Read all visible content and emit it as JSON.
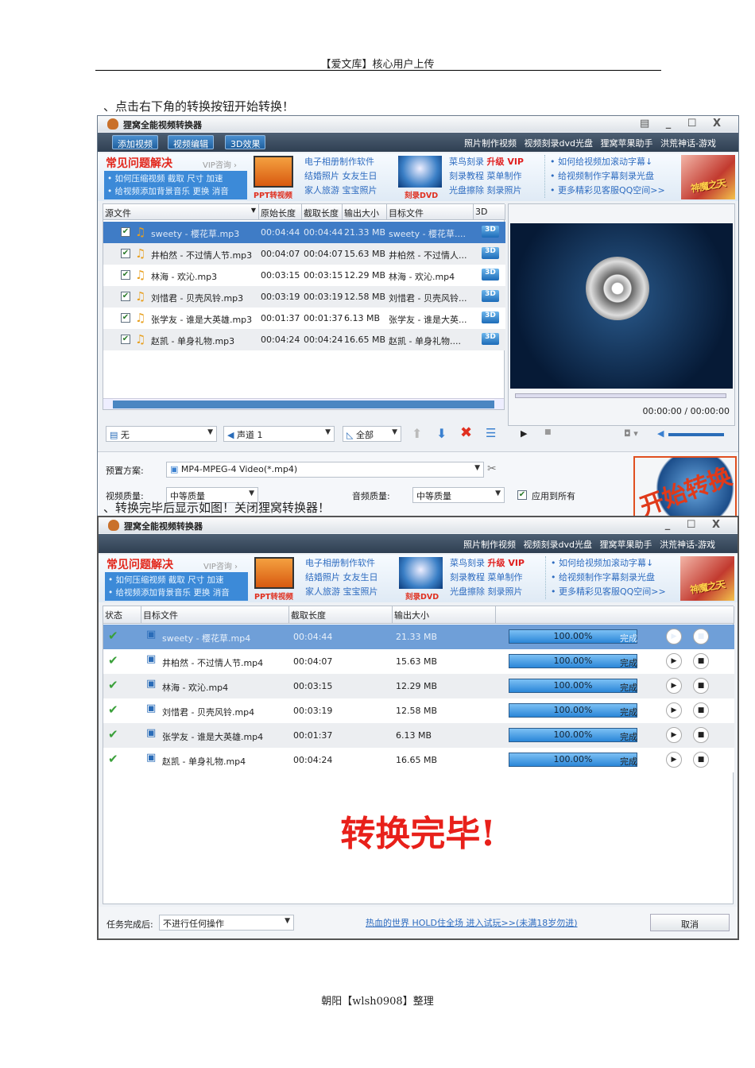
{
  "doc": {
    "header": "【爱文库】核心用户上传",
    "step1": "、点击右下角的转换按钮开始转换！",
    "step2": "、转换完毕后显示如图！关闭狸窝转换器！",
    "footer": "朝阳【wlsh0908】整理"
  },
  "app": {
    "title": "狸窝全能视频转换器",
    "window_controls": "▤ _ ☐ X",
    "toolbar": {
      "add_video": "添加视频",
      "edit_video": "视频编辑",
      "effect_3d": "3D效果"
    },
    "top_links": [
      "照片制作视频",
      "视频刻录dvd光盘",
      "狸窝苹果助手",
      "洪荒神话-游戏"
    ],
    "banner": {
      "faq": "常见问题解决",
      "vip": "VIP咨询 ›",
      "faq_links": [
        "• 如何压缩视频 截取 尺寸 加速",
        "• 给视频添加背景音乐 更换 消音"
      ],
      "ppt_label": "PPT转视频",
      "col2": [
        "电子相册制作软件",
        "结婚照片 女友生日",
        "家人旅游 宝宝照片"
      ],
      "dvd_label": "刻录DVD",
      "col3": [
        "菜鸟刻录",
        "升级 VIP",
        "刻录教程 菜单制作",
        "光盘擦除 刻录照片"
      ],
      "col4": [
        "• 如何给视频加滚动字幕↓",
        "• 给视频制作字幕刻录光盘",
        "• 更多精彩见客服QQ空间>>"
      ],
      "game": "神魔之天"
    }
  },
  "window1": {
    "columns": [
      "源文件",
      "原始长度",
      "截取长度",
      "输出大小",
      "目标文件",
      "3D"
    ],
    "rows": [
      {
        "src": "sweety - 樱花草.mp3",
        "orig": "00:04:44",
        "cut": "00:04:44",
        "size": "21.33 MB",
        "target": "sweety - 樱花草....",
        "badge": "3D"
      },
      {
        "src": "井柏然 - 不过情人节.mp3",
        "orig": "00:04:07",
        "cut": "00:04:07",
        "size": "15.63 MB",
        "target": "井柏然 - 不过情人...",
        "badge": "3D"
      },
      {
        "src": "林海 - 欢沁.mp3",
        "orig": "00:03:15",
        "cut": "00:03:15",
        "size": "12.29 MB",
        "target": "林海 - 欢沁.mp4",
        "badge": "3D"
      },
      {
        "src": "刘惜君 - 贝壳风铃.mp3",
        "orig": "00:03:19",
        "cut": "00:03:19",
        "size": "12.58 MB",
        "target": "刘惜君 - 贝壳风铃...",
        "badge": "3D"
      },
      {
        "src": "张学友 - 谁是大英雄.mp3",
        "orig": "00:01:37",
        "cut": "00:01:37",
        "size": "6.13 MB",
        "target": "张学友 - 谁是大英...",
        "badge": "3D"
      },
      {
        "src": "赵凯 - 单身礼物.mp3",
        "orig": "00:04:24",
        "cut": "00:04:24",
        "size": "16.65 MB",
        "target": "赵凯 - 单身礼物....",
        "badge": "3D"
      }
    ],
    "player_time": "00:00:00 / 00:00:00",
    "subtitle": "无",
    "audio_track": "声道 1",
    "scope": "全部",
    "preset_label": "预置方案:",
    "preset_value": "MP4-MPEG-4 Video(*.mp4)",
    "video_quality_label": "视频质量:",
    "video_quality": "中等质量",
    "audio_quality_label": "音频质量:",
    "audio_quality": "中等质量",
    "apply_all": "应用到所有",
    "start_button": "开始转换"
  },
  "window2": {
    "columns": [
      "状态",
      "目标文件",
      "截取长度",
      "输出大小"
    ],
    "rows": [
      {
        "file": "sweety - 樱花草.mp4",
        "cut": "00:04:44",
        "size": "21.33 MB",
        "progress": "100.00%",
        "status": "完成"
      },
      {
        "file": "井柏然 - 不过情人节.mp4",
        "cut": "00:04:07",
        "size": "15.63 MB",
        "progress": "100.00%",
        "status": "完成"
      },
      {
        "file": "林海 - 欢沁.mp4",
        "cut": "00:03:15",
        "size": "12.29 MB",
        "progress": "100.00%",
        "status": "完成"
      },
      {
        "file": "刘惜君 - 贝壳风铃.mp4",
        "cut": "00:03:19",
        "size": "12.58 MB",
        "progress": "100.00%",
        "status": "完成"
      },
      {
        "file": "张学友 - 谁是大英雄.mp4",
        "cut": "00:01:37",
        "size": "6.13 MB",
        "progress": "100.00%",
        "status": "完成"
      },
      {
        "file": "赵凯 - 单身礼物.mp4",
        "cut": "00:04:24",
        "size": "16.65 MB",
        "progress": "100.00%",
        "status": "完成"
      }
    ],
    "done_message": "转换完毕!",
    "after_label": "任务完成后:",
    "after_value": "不进行任何操作",
    "ad_link": "热血的世界 HOLD住全场 进入试玩>>(未满18岁勿进)",
    "cancel": "取消"
  }
}
